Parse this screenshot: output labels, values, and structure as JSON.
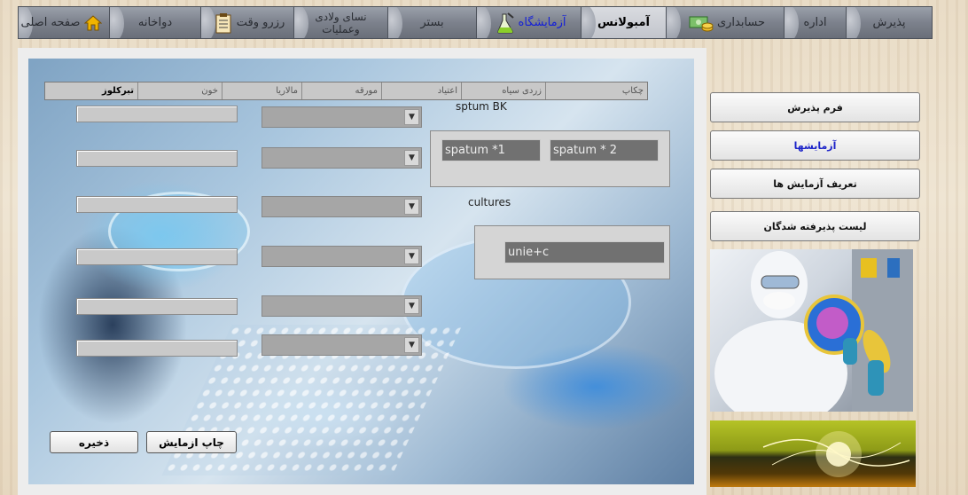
{
  "topnav": {
    "tabs": [
      {
        "label": "صفحه اصلی",
        "icon": "home-icon",
        "active": false
      },
      {
        "label": "دواخانه",
        "icon": "",
        "active": false
      },
      {
        "label": "رزرو وقت",
        "icon": "clipboard-icon",
        "active": false
      },
      {
        "label": "نسای ولادی وعملیات",
        "icon": "",
        "active": false
      },
      {
        "label": "بستر",
        "icon": "",
        "active": false
      },
      {
        "label": "آزمایشگاه",
        "icon": "flask-icon",
        "active": false
      },
      {
        "label": "آمبولانس",
        "icon": "",
        "active": true
      },
      {
        "label": "حسابداری",
        "icon": "money-icon",
        "active": false
      },
      {
        "label": "اداره",
        "icon": "",
        "active": false
      },
      {
        "label": "پذیرش",
        "icon": "",
        "active": false
      }
    ]
  },
  "subtabs": [
    {
      "label": "چکاپ"
    },
    {
      "label": "زردی سیاه"
    },
    {
      "label": "اعتیاد"
    },
    {
      "label": "مورقه"
    },
    {
      "label": "مالاریا"
    },
    {
      "label": "خون"
    },
    {
      "label": "تبرکلوز",
      "active": true
    }
  ],
  "sputum": {
    "title": "sptum BK",
    "field1": "spatum *1",
    "field2": "spatum * 2"
  },
  "cultures": {
    "title": "cultures",
    "field": "unie+c"
  },
  "buttons": {
    "print": "چاپ ازمایش",
    "save": "ذخیره"
  },
  "sidebar": {
    "items": [
      {
        "label": "فرم پذیرش"
      },
      {
        "label": "آزمایشها",
        "highlight": true
      },
      {
        "label": "تعریف آزمایش ها"
      },
      {
        "label": "لیست پذیرفته شدگان"
      }
    ]
  },
  "colors": {
    "nav_tab": "#7c818c",
    "nav_active": "#c2c5cc",
    "link_blue": "#1520d8",
    "panel": "#ededed"
  }
}
